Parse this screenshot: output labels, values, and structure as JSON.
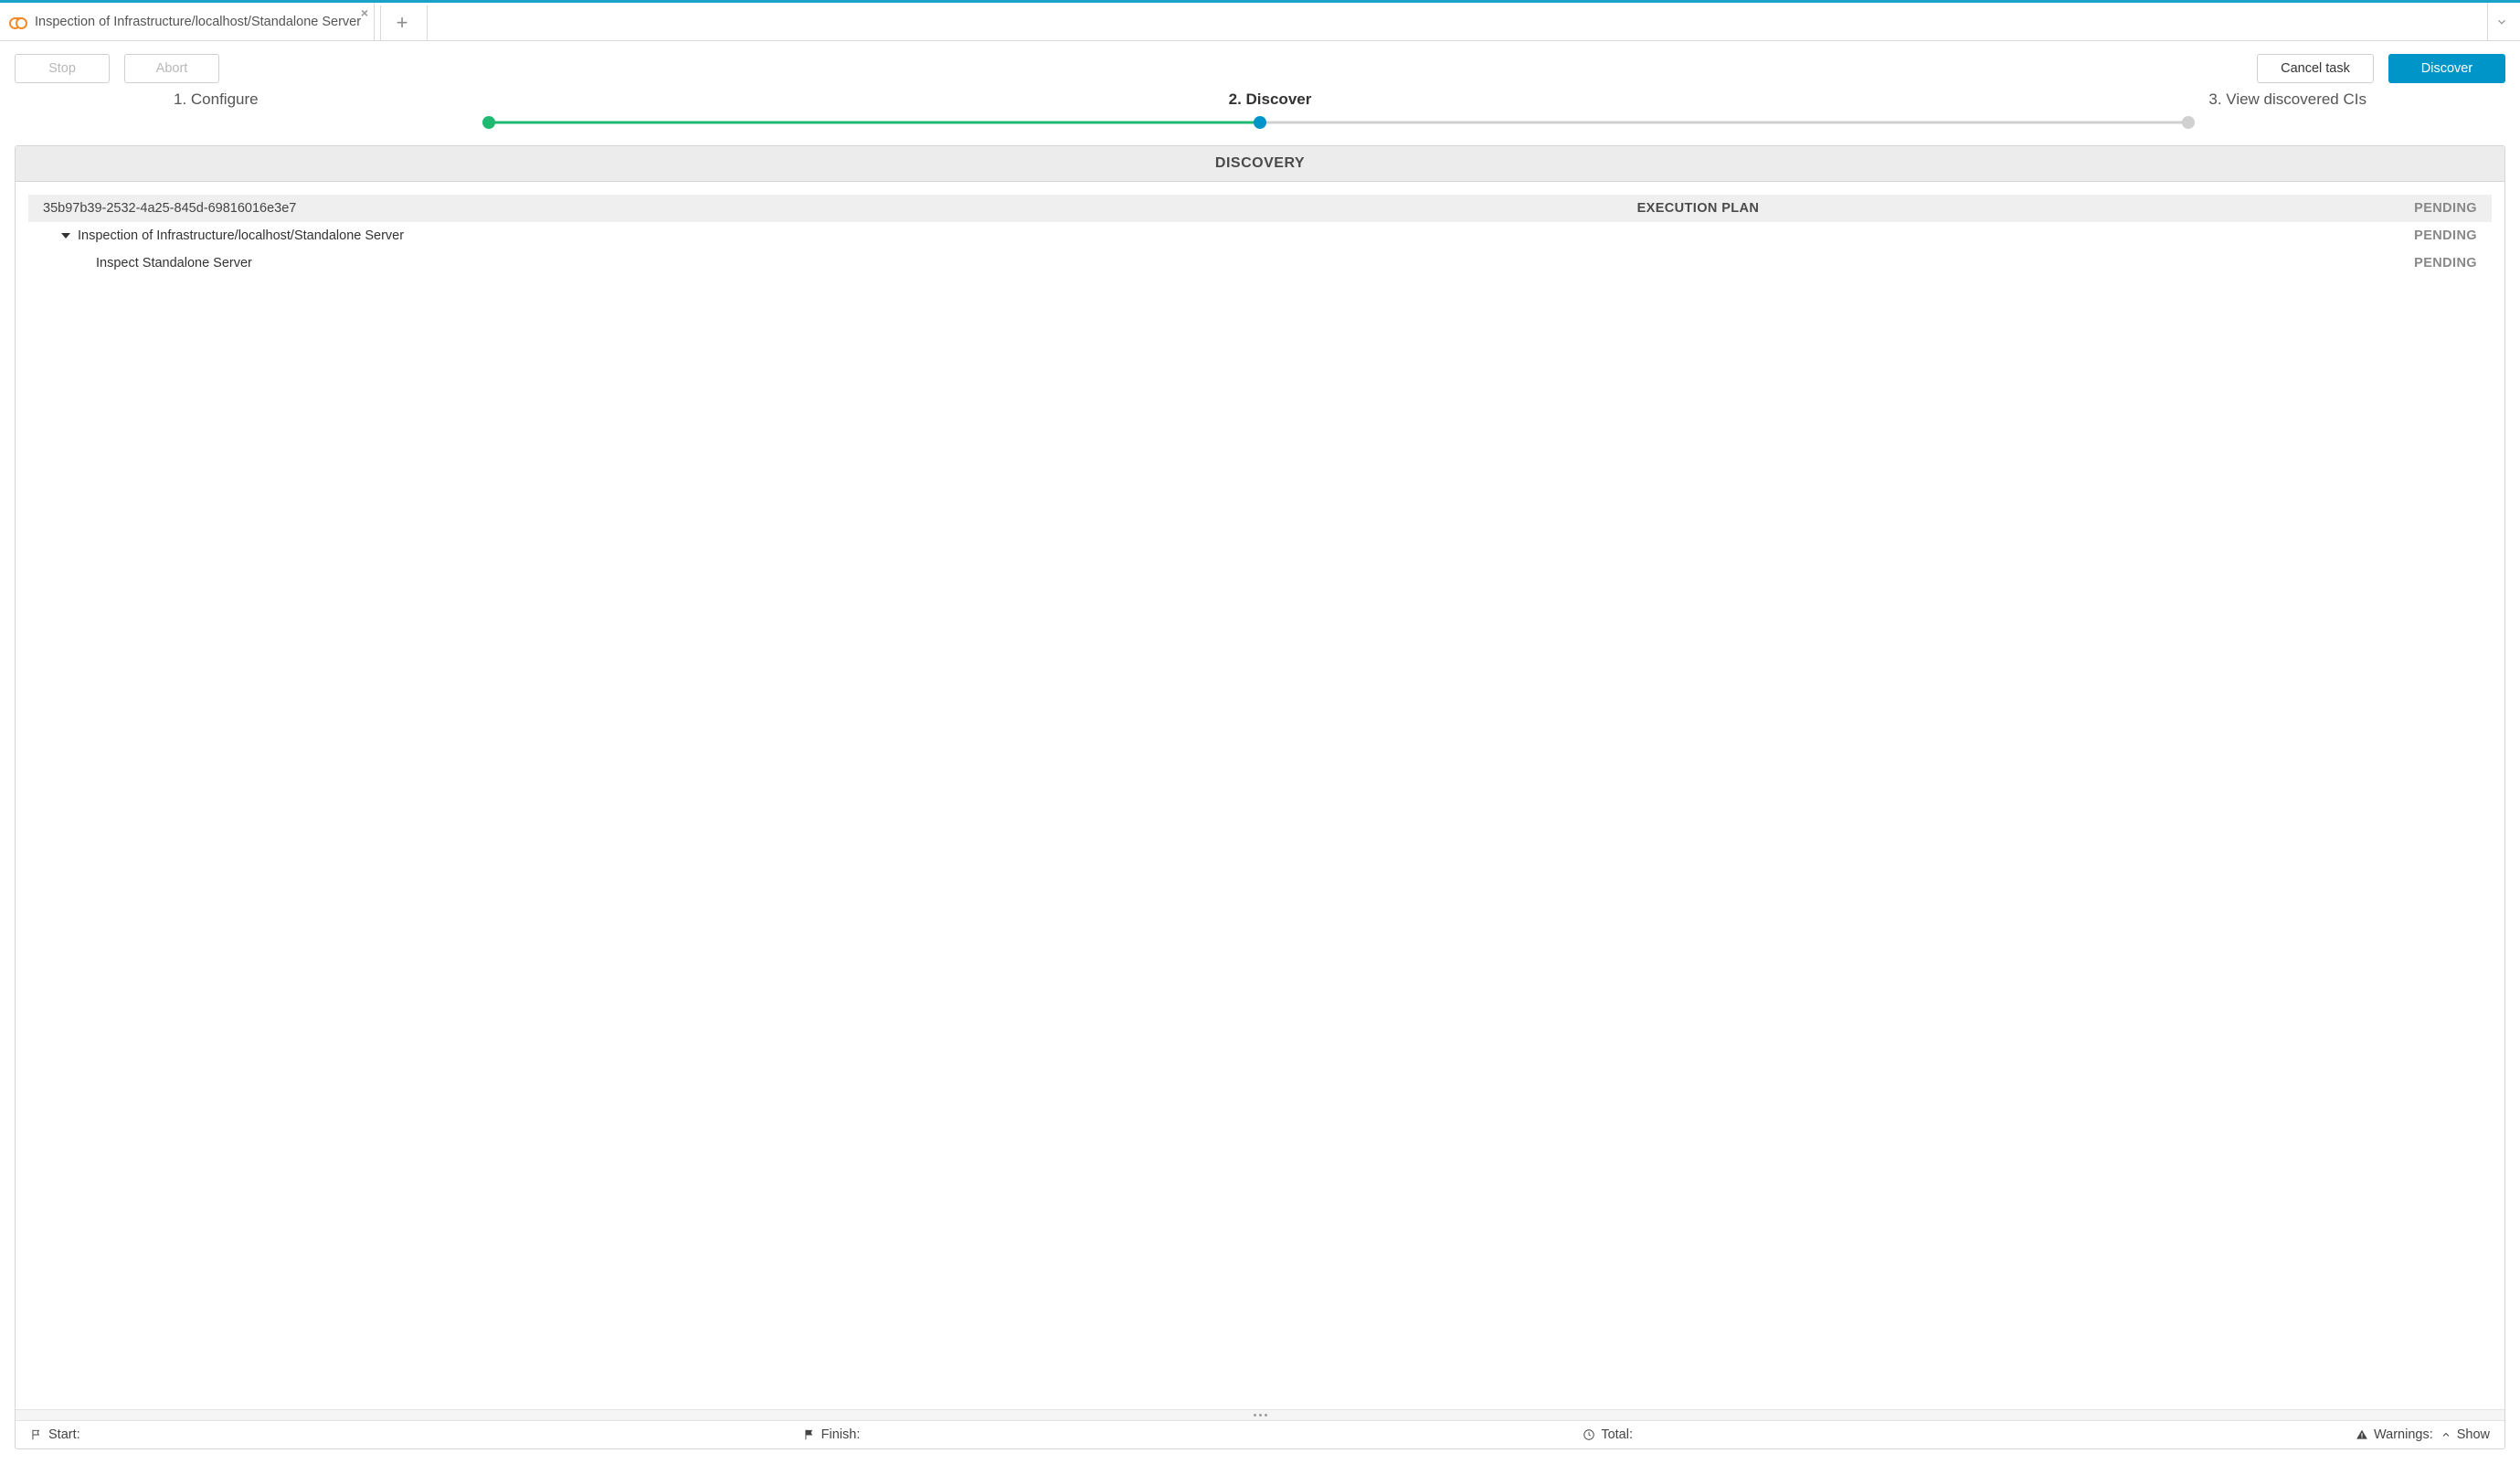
{
  "tab": {
    "title": "Inspection of Infrastructure/localhost/Standalone Server"
  },
  "actions": {
    "stop": "Stop",
    "abort": "Abort",
    "cancel": "Cancel task",
    "discover": "Discover"
  },
  "stepper": {
    "steps": [
      "1. Configure",
      "2. Discover",
      "3. View discovered CIs"
    ],
    "active_index": 1,
    "colors": {
      "done": "#1fb971",
      "active": "#0095c8",
      "future": "#d0d0d0"
    }
  },
  "panel": {
    "title": "DISCOVERY"
  },
  "execution": {
    "center_title": "EXECUTION PLAN",
    "id": "35b97b39-2532-4a25-845d-69816016e3e7",
    "rows": [
      {
        "indent": 0,
        "label": "35b97b39-2532-4a25-845d-69816016e3e7",
        "status": "PENDING",
        "header": true
      },
      {
        "indent": 1,
        "label": "Inspection of Infrastructure/localhost/Standalone Server",
        "status": "PENDING",
        "collapsible": true
      },
      {
        "indent": 2,
        "label": "Inspect Standalone Server",
        "status": "PENDING"
      }
    ]
  },
  "footer": {
    "start": "Start:",
    "finish": "Finish:",
    "total": "Total:",
    "warnings": "Warnings:",
    "show": "Show"
  }
}
